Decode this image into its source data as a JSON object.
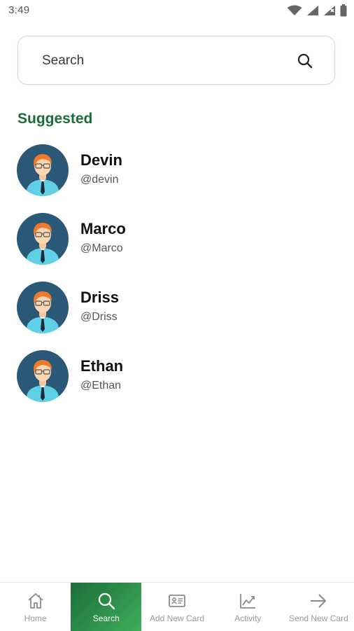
{
  "status_bar": {
    "time": "3:49"
  },
  "search": {
    "placeholder": "Search"
  },
  "suggested": {
    "title": "Suggested",
    "users": [
      {
        "name": "Devin",
        "handle": "@devin"
      },
      {
        "name": "Marco",
        "handle": "@Marco"
      },
      {
        "name": "Driss",
        "handle": "@Driss"
      },
      {
        "name": "Ethan",
        "handle": "@Ethan"
      }
    ]
  },
  "bottom_nav": {
    "items": [
      {
        "label": "Home",
        "icon": "home-icon",
        "active": false
      },
      {
        "label": "Search",
        "icon": "search-icon",
        "active": true
      },
      {
        "label": "Add New Card",
        "icon": "card-icon",
        "active": false
      },
      {
        "label": "Activity",
        "icon": "activity-chart-icon",
        "active": false
      },
      {
        "label": "Send New Card",
        "icon": "arrow-right-icon",
        "active": false
      }
    ]
  },
  "colors": {
    "accent": "#1e6b3a",
    "nav_active_start": "#1b6e3a",
    "nav_active_end": "#3fae5a",
    "avatar_bg": "#2b5876"
  }
}
